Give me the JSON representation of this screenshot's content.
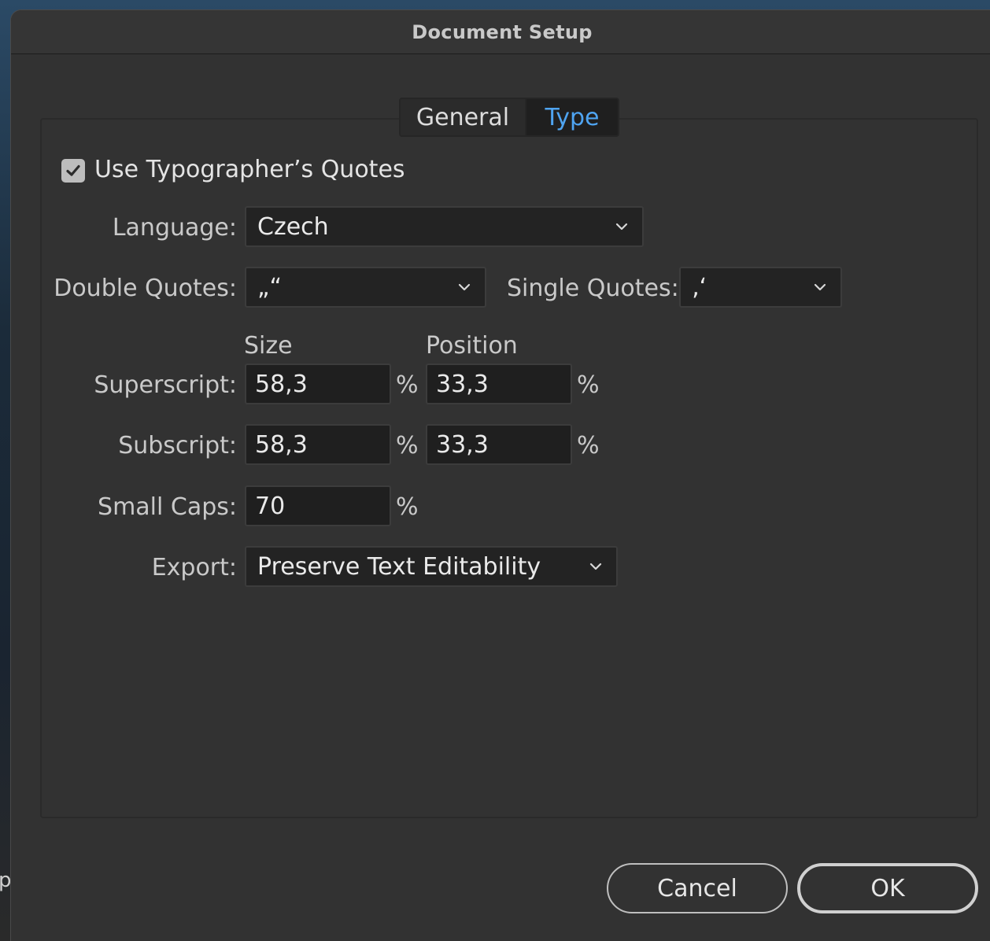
{
  "window": {
    "title": "Document Setup"
  },
  "tabs": [
    {
      "label": "General",
      "selected": false
    },
    {
      "label": "Type",
      "selected": true
    }
  ],
  "typographers_quotes": {
    "label": "Use Typographer’s Quotes",
    "checked": true
  },
  "language": {
    "label": "Language:",
    "value": "Czech"
  },
  "double_quotes": {
    "label": "Double Quotes:",
    "value": "„“"
  },
  "single_quotes": {
    "label": "Single Quotes:",
    "value": "‚‘"
  },
  "columns": {
    "size": "Size",
    "position": "Position"
  },
  "superscript": {
    "label": "Superscript:",
    "size": "58,3",
    "position": "33,3"
  },
  "subscript": {
    "label": "Subscript:",
    "size": "58,3",
    "position": "33,3"
  },
  "small_caps": {
    "label": "Small Caps:",
    "value": "70"
  },
  "percent_unit": "%",
  "export": {
    "label": "Export:",
    "value": "Preserve Text Editability"
  },
  "buttons": {
    "cancel": "Cancel",
    "ok": "OK"
  },
  "background_glyph": "p",
  "colors": {
    "accent": "#4fa4f1",
    "dialog_bg": "#323232",
    "field_bg": "#1f1f1f"
  }
}
